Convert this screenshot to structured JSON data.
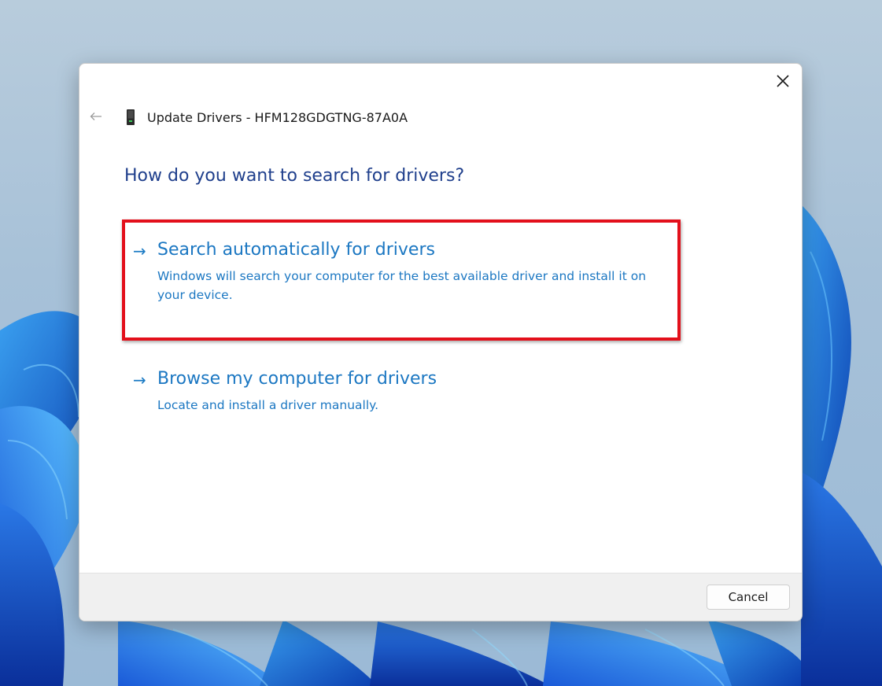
{
  "window": {
    "title": "Update Drivers - HFM128GDGTNG-87A0A",
    "back_icon": "back-arrow-icon",
    "close_icon": "close-icon",
    "device_icon": "storage-device-icon"
  },
  "main": {
    "heading": "How do you want to search for drivers?",
    "options": [
      {
        "arrow": "→",
        "title": "Search automatically for drivers",
        "description": "Windows will search your computer for the best available driver and install it on your device.",
        "highlighted": true
      },
      {
        "arrow": "→",
        "title": "Browse my computer for drivers",
        "description": "Locate and install a driver manually.",
        "highlighted": false
      }
    ]
  },
  "footer": {
    "cancel_label": "Cancel"
  },
  "colors": {
    "heading": "#1f3f8c",
    "link": "#1b77c2",
    "highlight": "#e3101b",
    "footer_bg": "#f0f0f0"
  }
}
